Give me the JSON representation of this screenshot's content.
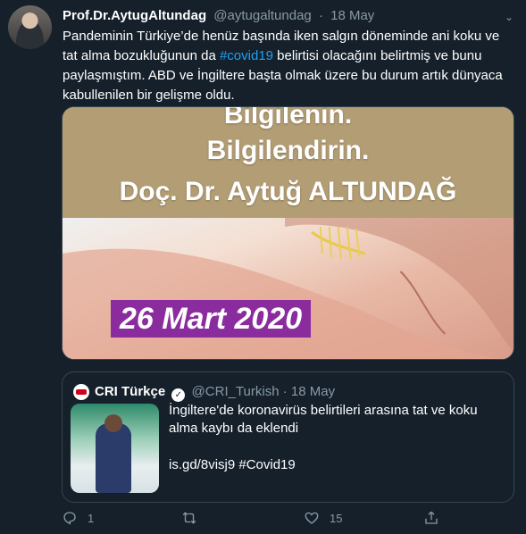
{
  "tweet": {
    "display_name": "Prof.Dr.AytugAltundag",
    "handle": "@aytugaltundag",
    "separator": "·",
    "date": "18 May",
    "text_before": "Pandeminin Türkiye’de henüz başında iken salgın döneminde ani koku ve tat alma bozukluğunun da ",
    "hashtag": "#covid19",
    "text_after": " belirtisi olacağını belirtmiş ve bunu paylaşmıştım. ABD ve İngiltere başta olmak üzere bu durum artık dünyaca kabullenilen bir gelişme oldu.",
    "caret_icon": "chevron-down-icon"
  },
  "media": {
    "line1": "Bilgilenin.",
    "line2": "Bilgilendirin.",
    "line3": "Doç. Dr. Aytuğ ALTUNDAĞ",
    "date_tag": "26 Mart 2020"
  },
  "quote": {
    "display_name": "CRI Türkçe",
    "verified_icon": "verified-badge-icon",
    "handle": "@CRI_Turkish",
    "separator": "·",
    "date": "18 May",
    "text": "İngiltere'de koronavirüs belirtileri arasına tat ve koku alma kaybı da eklendi",
    "link_line": "is.gd/8visj9 #Covid19"
  },
  "actions": {
    "reply_count": "1",
    "retweet_count": "",
    "like_count": "15"
  },
  "colors": {
    "background": "#15202b",
    "text_primary": "#ffffff",
    "text_secondary": "#8899a6",
    "link": "#1da1f2",
    "border": "#38444d",
    "date_tag_bg": "#8a2c9e"
  }
}
